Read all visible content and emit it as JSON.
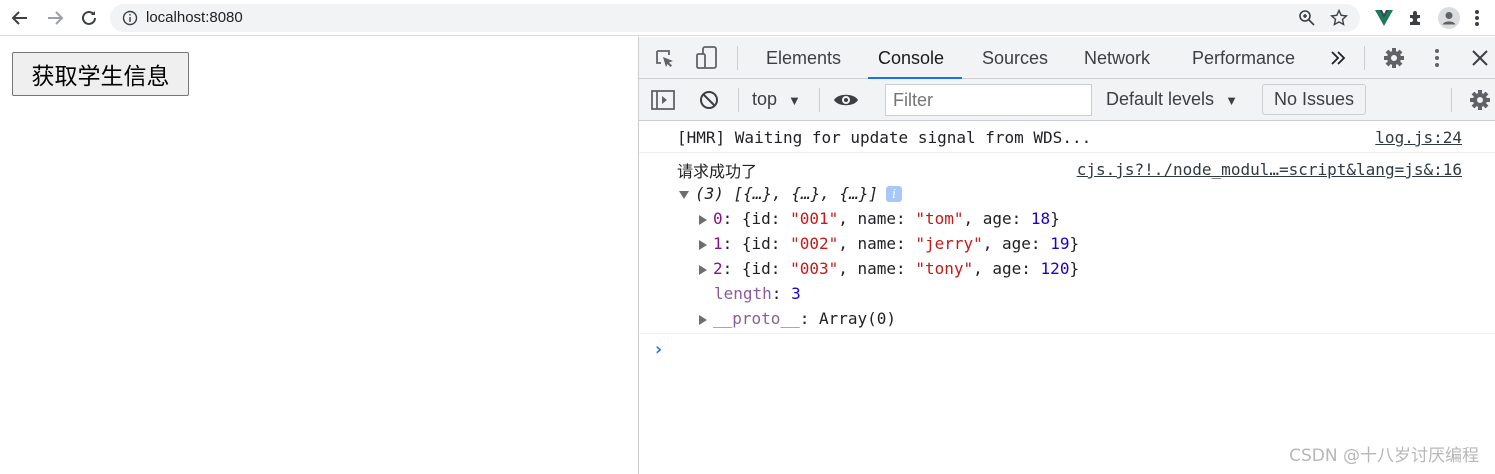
{
  "browser": {
    "url": "localhost:8080"
  },
  "page": {
    "button_label": "获取学生信息"
  },
  "devtools": {
    "tabs": [
      "Elements",
      "Console",
      "Sources",
      "Network",
      "Performance"
    ],
    "active_tab": "Console",
    "context": "top",
    "filter_placeholder": "Filter",
    "levels": "Default levels",
    "issues": "No Issues"
  },
  "console": {
    "hmr_text": "[HMR] Waiting for update signal from WDS...",
    "hmr_source": "log.js:24",
    "log_text": "请求成功了",
    "log_source": "cjs.js?!./node_modul…=script&lang=js&:16",
    "array_summary": "(3) [{…}, {…}, {…}]",
    "info_badge": "i",
    "items": [
      {
        "index": "0",
        "id": "\"001\"",
        "name": "\"tom\"",
        "age": "18"
      },
      {
        "index": "1",
        "id": "\"002\"",
        "name": "\"jerry\"",
        "age": "19"
      },
      {
        "index": "2",
        "id": "\"003\"",
        "name": "\"tony\"",
        "age": "120"
      }
    ],
    "length_key": "length",
    "length_value": "3",
    "proto_key": "__proto__",
    "proto_value": "Array(0)",
    "prompt": "›"
  },
  "watermark": "CSDN @十八岁讨厌编程",
  "colors": {
    "accent": "#1a73e8",
    "string": "#c41a16",
    "number": "#1c00cf",
    "vue": "#1b7a5a"
  }
}
